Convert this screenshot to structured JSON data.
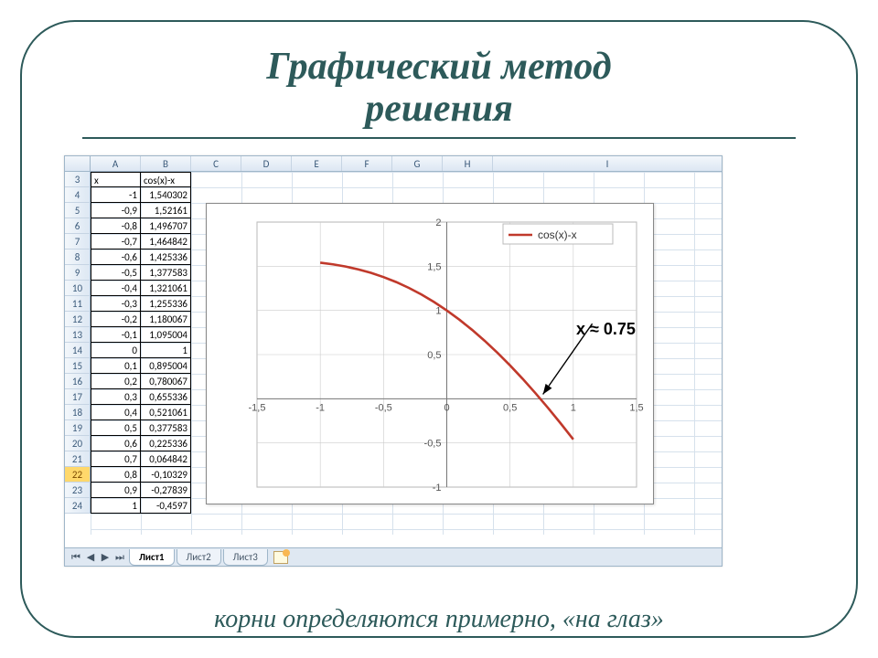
{
  "title_line1": "Графический метод",
  "title_line2": "решения",
  "footer": "корни определяются примерно, «на глаз»",
  "annotation": "x ≈ 0.75",
  "sheet": {
    "columns": [
      "A",
      "B",
      "C",
      "D",
      "E",
      "F",
      "G",
      "H",
      "I"
    ],
    "headers": {
      "A": "x",
      "B": "cos(x)-x"
    },
    "rows": [
      {
        "n": 3,
        "x": "",
        "y": ""
      },
      {
        "n": 4,
        "x": "-1",
        "y": "1,540302"
      },
      {
        "n": 5,
        "x": "-0,9",
        "y": "1,52161"
      },
      {
        "n": 6,
        "x": "-0,8",
        "y": "1,496707"
      },
      {
        "n": 7,
        "x": "-0,7",
        "y": "1,464842"
      },
      {
        "n": 8,
        "x": "-0,6",
        "y": "1,425336"
      },
      {
        "n": 9,
        "x": "-0,5",
        "y": "1,377583"
      },
      {
        "n": 10,
        "x": "-0,4",
        "y": "1,321061"
      },
      {
        "n": 11,
        "x": "-0,3",
        "y": "1,255336"
      },
      {
        "n": 12,
        "x": "-0,2",
        "y": "1,180067"
      },
      {
        "n": 13,
        "x": "-0,1",
        "y": "1,095004"
      },
      {
        "n": 14,
        "x": "0",
        "y": "1"
      },
      {
        "n": 15,
        "x": "0,1",
        "y": "0,895004"
      },
      {
        "n": 16,
        "x": "0,2",
        "y": "0,780067"
      },
      {
        "n": 17,
        "x": "0,3",
        "y": "0,655336"
      },
      {
        "n": 18,
        "x": "0,4",
        "y": "0,521061"
      },
      {
        "n": 19,
        "x": "0,5",
        "y": "0,377583"
      },
      {
        "n": 20,
        "x": "0,6",
        "y": "0,225336"
      },
      {
        "n": 21,
        "x": "0,7",
        "y": "0,064842"
      },
      {
        "n": 22,
        "x": "0,8",
        "y": "-0,10329",
        "hl": true
      },
      {
        "n": 23,
        "x": "0,9",
        "y": "-0,27839"
      },
      {
        "n": 24,
        "x": "1",
        "y": "-0,4597"
      }
    ],
    "tabs": [
      "Лист1",
      "Лист2",
      "Лист3"
    ],
    "active_tab": 0
  },
  "chart_data": {
    "type": "line",
    "title": "",
    "legend": "cos(x)-x",
    "xlabel": "",
    "ylabel": "",
    "xlim": [
      -1.5,
      1.5
    ],
    "ylim": [
      -1,
      2
    ],
    "xticks": [
      -1.5,
      -1,
      -0.5,
      0,
      0.5,
      1,
      1.5
    ],
    "yticks": [
      -1,
      -0.5,
      0,
      0.5,
      1,
      1.5,
      2
    ],
    "x": [
      -1,
      -0.9,
      -0.8,
      -0.7,
      -0.6,
      -0.5,
      -0.4,
      -0.3,
      -0.2,
      -0.1,
      0,
      0.1,
      0.2,
      0.3,
      0.4,
      0.5,
      0.6,
      0.7,
      0.8,
      0.9,
      1
    ],
    "y": [
      1.540302,
      1.52161,
      1.496707,
      1.464842,
      1.425336,
      1.377583,
      1.321061,
      1.255336,
      1.180067,
      1.095004,
      1,
      0.895004,
      0.780067,
      0.655336,
      0.521061,
      0.377583,
      0.225336,
      0.064842,
      -0.10329,
      -0.27839,
      -0.4597
    ]
  }
}
